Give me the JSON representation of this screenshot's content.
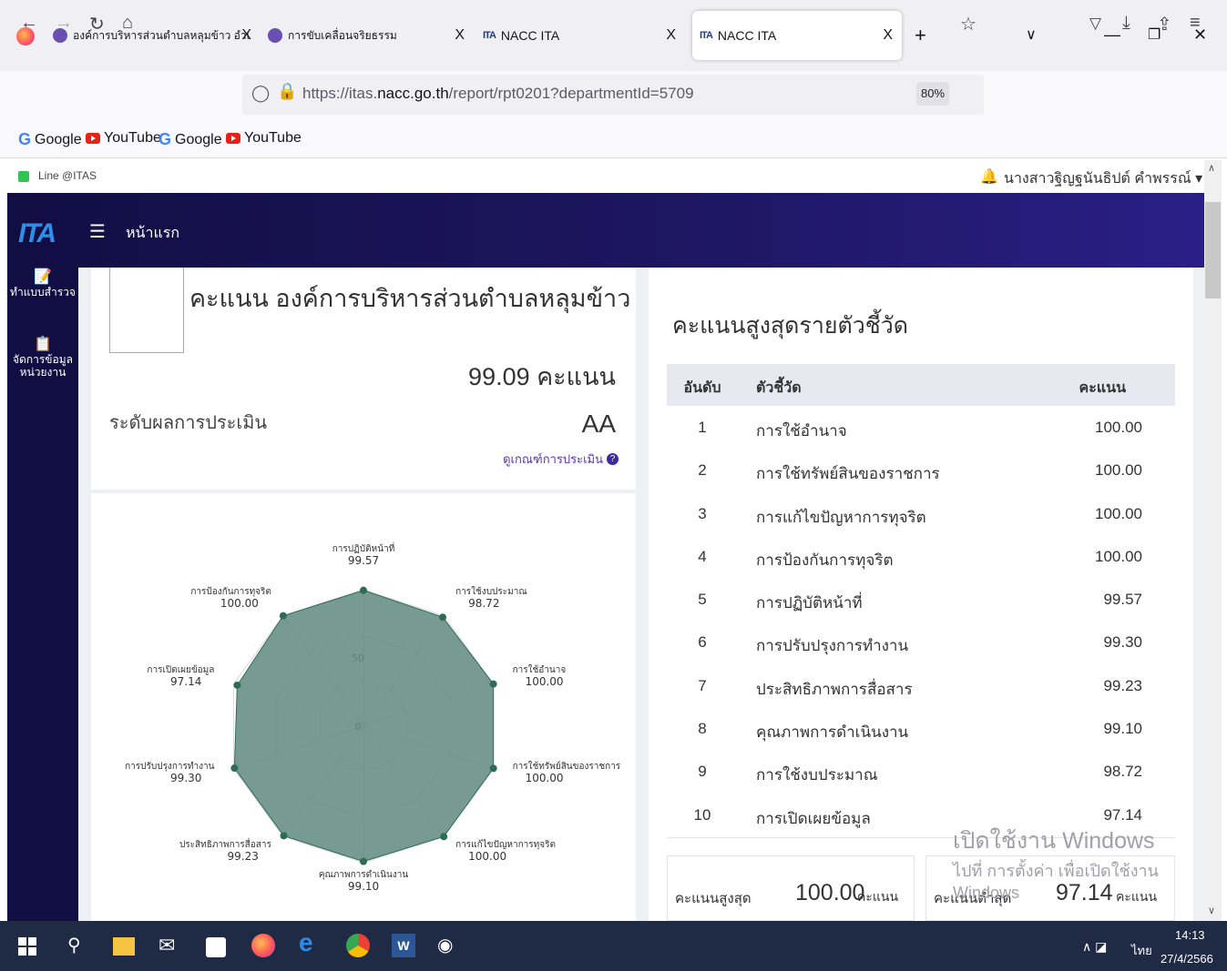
{
  "browser": {
    "tabs": [
      {
        "label": "องค์การบริหารส่วนตำบลหลุมข้าว อำเ",
        "close": "X"
      },
      {
        "label": "การขับเคลื่อนจริยธรรม",
        "close": "X"
      },
      {
        "label": "NACC ITA",
        "close": "X",
        "favicon": "ITA"
      },
      {
        "label": "NACC ITA",
        "close": "X",
        "favicon": "ITA",
        "active": true
      }
    ],
    "new_tab": "+",
    "url_prefix": "https://itas.",
    "url_domain": "nacc.go.th",
    "url_path": "/report/rpt0201?departmentId=5709",
    "zoom": "80%",
    "bookmarks": [
      {
        "label": "Google",
        "icon": "google-icon"
      },
      {
        "label": "YouTube",
        "icon": "youtube-icon"
      },
      {
        "label": "Google",
        "icon": "google-icon"
      },
      {
        "label": "YouTube",
        "icon": "youtube-icon"
      }
    ]
  },
  "page": {
    "line_link": "Line @ITAS",
    "user_name": "นางสาวฐิญฐนันธิปต์ คำพรรณ์ ▾",
    "nav_home": "หน้าแรก",
    "sidebar": [
      {
        "label": "ทำแบบสำรวจ",
        "icon": "form-icon"
      },
      {
        "label": "จัดการข้อมูล หน่วยงาน",
        "icon": "clipboard-icon"
      }
    ],
    "score_title": "คะแนน องค์การบริหารส่วนตำบลหลุมข้าว",
    "total_score": "99.09 คะแนน",
    "level_label": "ระดับผลการประเมิน",
    "level_value": "AA",
    "criteria_link": "ดูเกณฑ์การประเมิน"
  },
  "chart_data": {
    "type": "radar",
    "rlim": [
      0,
      100
    ],
    "tick_labels": [
      "0",
      "50"
    ],
    "axes": [
      {
        "label": "การปฏิบัติหน้าที่",
        "value": 99.57
      },
      {
        "label": "การใช้งบประมาณ",
        "value": 98.72
      },
      {
        "label": "การใช้อำนาจ",
        "value": 100.0
      },
      {
        "label": "การใช้ทรัพย์สินของราชการ",
        "value": 100.0
      },
      {
        "label": "การแก้ไขปัญหาการทุจริต",
        "value": 100.0
      },
      {
        "label": "คุณภาพการดำเนินงาน",
        "value": 99.1
      },
      {
        "label": "ประสิทธิภาพการสื่อสาร",
        "value": 99.23
      },
      {
        "label": "การปรับปรุงการทำงาน",
        "value": 99.3
      },
      {
        "label": "การเปิดเผยข้อมูล",
        "value": 97.14
      },
      {
        "label": "การป้องกันการทุจริต",
        "value": 100.0
      }
    ],
    "value_labels": [
      "99.57",
      "98.72",
      "100.00",
      "100.00",
      "100.00",
      "99.10",
      "99.23",
      "99.30",
      "97.14",
      "100.00"
    ],
    "fill_color": "#5f8a7c",
    "point_color": "#2e6b57"
  },
  "ranking": {
    "title": "คะแนนสูงสุดรายตัวชี้วัด",
    "headers": {
      "rank": "อันดับ",
      "indicator": "ตัวชี้วัด",
      "score": "คะแนน"
    },
    "rows": [
      {
        "rank": "1",
        "indicator": "การใช้อำนาจ",
        "score": "100.00"
      },
      {
        "rank": "2",
        "indicator": "การใช้ทรัพย์สินของราชการ",
        "score": "100.00"
      },
      {
        "rank": "3",
        "indicator": "การแก้ไขปัญหาการทุจริต",
        "score": "100.00"
      },
      {
        "rank": "4",
        "indicator": "การป้องกันการทุจริต",
        "score": "100.00"
      },
      {
        "rank": "5",
        "indicator": "การปฏิบัติหน้าที่",
        "score": "99.57"
      },
      {
        "rank": "6",
        "indicator": "การปรับปรุงการทำงาน",
        "score": "99.30"
      },
      {
        "rank": "7",
        "indicator": "ประสิทธิภาพการสื่อสาร",
        "score": "99.23"
      },
      {
        "rank": "8",
        "indicator": "คุณภาพการดำเนินงาน",
        "score": "99.10"
      },
      {
        "rank": "9",
        "indicator": "การใช้งบประมาณ",
        "score": "98.72"
      },
      {
        "rank": "10",
        "indicator": "การเปิดเผยข้อมูล",
        "score": "97.14"
      }
    ],
    "max_label": "คะแนนสูงสุด",
    "max_value": "100.00",
    "min_label": "คะแนนต่ำสุด",
    "min_value": "97.14",
    "unit": "คะแนน"
  },
  "watermark": {
    "line1": "เปิดใช้งาน Windows",
    "line2": "ไปที่ การตั้งค่า เพื่อเปิดใช้งาน Windows"
  },
  "taskbar": {
    "time": "14:13",
    "date": "27/4/2566",
    "lang": "ไทย"
  }
}
